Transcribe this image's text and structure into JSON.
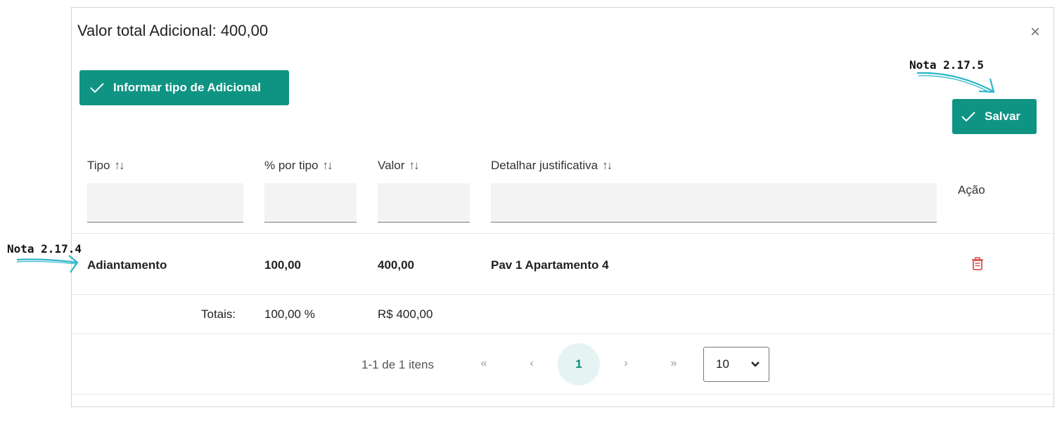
{
  "modal": {
    "title": "Valor total Adicional: 400,00",
    "close_glyph": "×",
    "informar_button_label": "Informar tipo de Adicional",
    "salvar_button_label": "Salvar"
  },
  "table": {
    "columns": [
      {
        "label": "Tipo",
        "sortable": true
      },
      {
        "label": "% por tipo",
        "sortable": true
      },
      {
        "label": "Valor",
        "sortable": true
      },
      {
        "label": "Detalhar justificativa",
        "sortable": true
      },
      {
        "label": "Ação",
        "sortable": false
      }
    ],
    "sort_glyph": "↑↓",
    "rows": [
      {
        "tipo": "Adiantamento",
        "percent": "100,00",
        "valor": "400,00",
        "justificativa": "Pav 1 Apartamento 4",
        "action_icon": "trash-icon"
      }
    ],
    "totals": {
      "label": "Totais:",
      "percent": "100,00 %",
      "valor": "R$ 400,00"
    }
  },
  "pagination": {
    "summary": "1-1 de 1 itens",
    "first": "«",
    "prev": "‹",
    "current_page": "1",
    "next": "›",
    "last": "»",
    "page_size": "10"
  },
  "annotations": {
    "note_row": "Nota 2.17.4",
    "note_save": "Nota 2.17.5"
  },
  "colors": {
    "accent": "#0f9483",
    "delete": "#d9534f",
    "annotation_arrow": "#2bb6c9"
  }
}
